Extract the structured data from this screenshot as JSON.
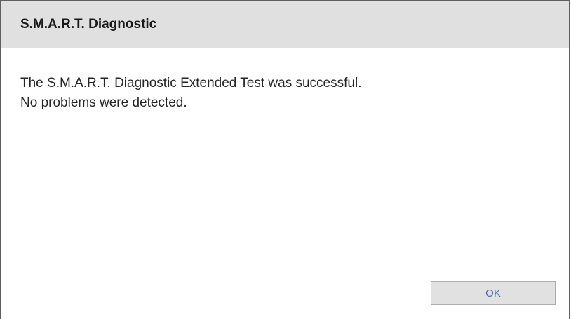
{
  "dialog": {
    "title": "S.M.A.R.T. Diagnostic",
    "message_lines": [
      "The S.M.A.R.T. Diagnostic Extended Test was successful.",
      "No problems were detected."
    ],
    "ok_label": "OK"
  },
  "colors": {
    "title_bar": "#e0e0e0",
    "button_text": "#4a6fa5",
    "button_bg": "#e1e1e1"
  }
}
